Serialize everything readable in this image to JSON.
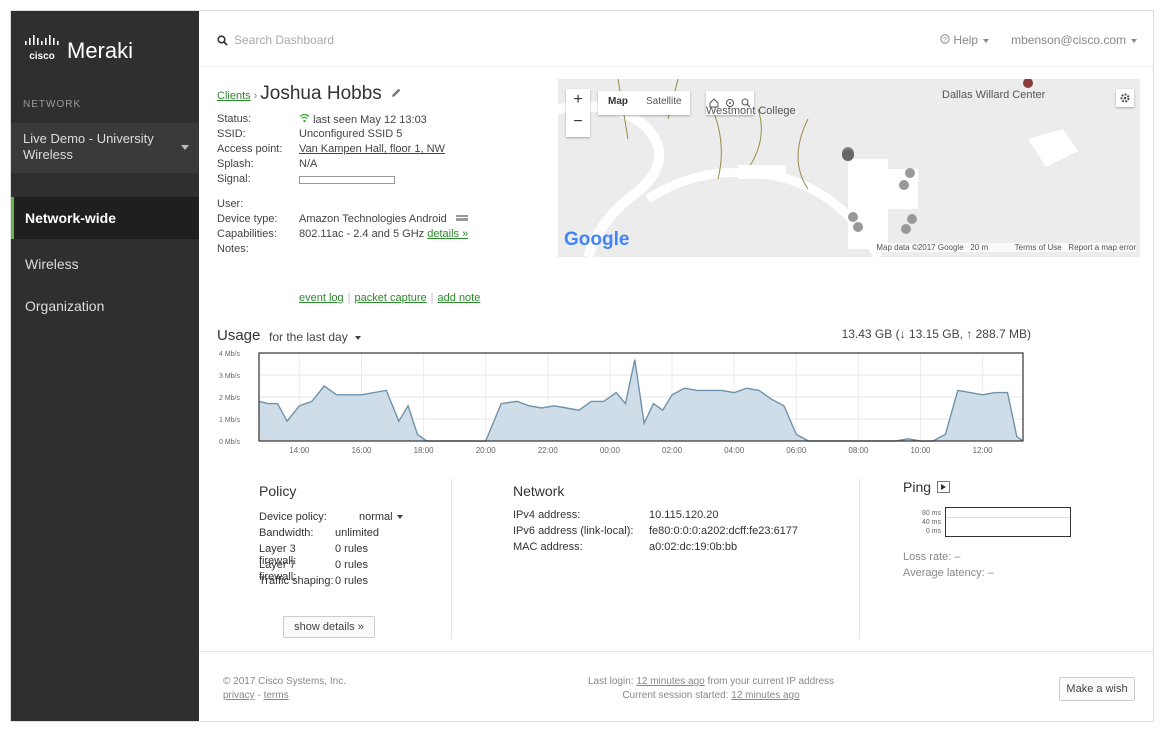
{
  "brand": {
    "logo_text": "cisco",
    "name": "Meraki"
  },
  "sidebar": {
    "network_label": "NETWORK",
    "network_name": "Live Demo - University Wireless",
    "items": [
      {
        "label": "Network-wide",
        "active": true
      },
      {
        "label": "Wireless",
        "active": false
      },
      {
        "label": "Organization",
        "active": false
      }
    ]
  },
  "topbar": {
    "search_placeholder": "Search Dashboard",
    "help_label": "Help",
    "user_email": "mbenson@cisco.com"
  },
  "client": {
    "breadcrumb_link": "Clients",
    "breadcrumb_sep": "›",
    "name": "Joshua Hobbs",
    "fields": {
      "status_label": "Status:",
      "status_value": "last seen May 12 13:03",
      "ssid_label": "SSID:",
      "ssid_value": "Unconfigured SSID 5",
      "ap_label": "Access point:",
      "ap_value": "Van Kampen Hall, floor 1, NW",
      "splash_label": "Splash:",
      "splash_value": "N/A",
      "signal_label": "Signal:",
      "user_label": "User:",
      "user_value": "",
      "device_type_label": "Device type:",
      "device_type_value": "Amazon Technologies Android",
      "capabilities_label": "Capabilities:",
      "capabilities_value": "802.11ac - 2.4 and 5 GHz",
      "details_link": "details »",
      "notes_label": "Notes:",
      "notes_value": ""
    },
    "actions": [
      "event log",
      "packet capture",
      "add note"
    ]
  },
  "map": {
    "labels": [
      "Westmont College",
      "Dallas Willard Center"
    ],
    "controls": {
      "zoom_in": "+",
      "zoom_out": "−",
      "map": "Map",
      "satellite": "Satellite"
    },
    "attribution": "Google",
    "footer": "Map data ©2017 Google   20 m            Terms of Use   Report a map error"
  },
  "usage": {
    "title": "Usage",
    "range": "for the last day",
    "total": "13.43 GB (↓ 13.15 GB, ↑ 288.7 MB)"
  },
  "chart_data": {
    "type": "area",
    "title": "",
    "xlabel": "",
    "ylabel": "",
    "y_unit": "Mb/s",
    "ylim": [
      0,
      4
    ],
    "y_ticks": [
      "4 Mb/s",
      "3 Mb/s",
      "2 Mb/s",
      "1 Mb/s",
      "0 Mb/s"
    ],
    "x_ticks": [
      "14:00",
      "16:00",
      "18:00",
      "20:00",
      "22:00",
      "00:00",
      "02:00",
      "04:00",
      "06:00",
      "08:00",
      "10:00",
      "12:00"
    ],
    "x_range": [
      12.7,
      37.3
    ],
    "x_tick_hours": [
      14,
      16,
      18,
      20,
      22,
      24,
      26,
      28,
      30,
      32,
      34,
      36
    ],
    "grid": true,
    "series": [
      {
        "hours": [
          12.7,
          13.0,
          13.3,
          13.6,
          14.0,
          14.4,
          14.8,
          15.2,
          15.6,
          16.0,
          16.4,
          16.8,
          17.2,
          17.5,
          17.8,
          18.1,
          18.3,
          18.6,
          19.0,
          19.5,
          20.0,
          20.5,
          21.0,
          21.4,
          21.8,
          22.2,
          22.6,
          23.0,
          23.4,
          23.8,
          24.2,
          24.5,
          24.8,
          25.1,
          25.4,
          25.7,
          26.0,
          26.4,
          26.8,
          27.2,
          27.6,
          28.0,
          28.4,
          28.8,
          29.2,
          29.6,
          30.0,
          30.4,
          30.8,
          31.2,
          31.6,
          32.0,
          32.4,
          32.8,
          33.2,
          33.6,
          34.0,
          34.4,
          34.8,
          35.2,
          35.6,
          36.0,
          36.4,
          36.8,
          37.1,
          37.3
        ],
        "values": [
          1.8,
          1.7,
          1.7,
          0.9,
          1.6,
          1.8,
          2.5,
          2.1,
          2.1,
          2.1,
          2.2,
          2.3,
          0.9,
          1.6,
          0.3,
          0.0,
          0.0,
          0.0,
          0.0,
          0.0,
          0.0,
          1.7,
          1.8,
          1.6,
          1.5,
          1.6,
          1.5,
          1.4,
          1.8,
          1.8,
          2.2,
          1.7,
          3.7,
          0.8,
          1.7,
          1.4,
          2.1,
          2.4,
          2.3,
          2.3,
          2.3,
          2.2,
          2.4,
          2.3,
          1.9,
          1.6,
          0.3,
          0.0,
          0.0,
          0.0,
          0.0,
          0.0,
          0.0,
          0.0,
          0.0,
          0.1,
          0.0,
          0.0,
          0.3,
          2.3,
          2.2,
          2.1,
          2.2,
          2.2,
          0.2,
          0.0
        ]
      }
    ]
  },
  "policy": {
    "title": "Policy",
    "rows": [
      {
        "k": "Device policy:",
        "v": "normal"
      },
      {
        "k": "Bandwidth:",
        "v": "unlimited"
      },
      {
        "k": "Layer 3 firewall:",
        "v": "0 rules"
      },
      {
        "k": "Layer 7 firewall:",
        "v": "0 rules"
      },
      {
        "k": "Traffic shaping:",
        "v": "0 rules"
      }
    ],
    "show_details": "show details »"
  },
  "network": {
    "title": "Network",
    "rows": [
      {
        "k": "IPv4 address:",
        "v": "10.115.120.20"
      },
      {
        "k": "IPv6 address (link-local):",
        "v": "fe80:0:0:0:a202:dcff:fe23:6177"
      },
      {
        "k": "MAC address:",
        "v": "a0:02:dc:19:0b:bb"
      }
    ]
  },
  "ping": {
    "title": "Ping",
    "ticks": [
      "80 ms",
      "40 ms",
      "0 ms"
    ],
    "loss_rate": "Loss rate: –",
    "avg_latency": "Average latency: –"
  },
  "footer": {
    "copyright": "© 2017 Cisco Systems, Inc.",
    "privacy": "privacy",
    "terms": "terms",
    "last_login_prefix": "Last login:",
    "last_login_link": "12 minutes ago",
    "last_login_suffix": "from your current IP address",
    "session_prefix": "Current session started:",
    "session_link": "12 minutes ago",
    "wish_button": "Make a wish"
  }
}
